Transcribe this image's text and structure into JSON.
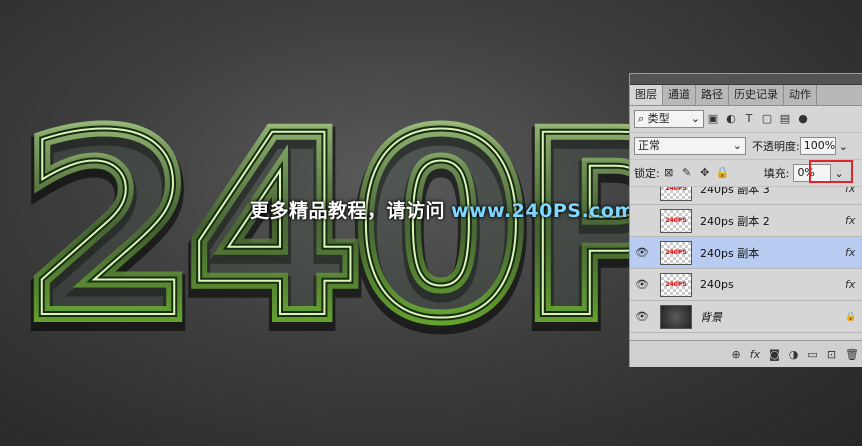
{
  "artwork": {
    "text": "240P"
  },
  "watermark": {
    "cn": "更多精品教程，请访问",
    "url": "www.240PS.com"
  },
  "panel": {
    "tabs": [
      "图层",
      "通道",
      "路径",
      "历史记录",
      "动作"
    ],
    "filter_label": "类型",
    "blend_mode": "正常",
    "opacity_label": "不透明度:",
    "opacity_value": "100%",
    "lock_label": "锁定:",
    "fill_label": "填充:",
    "fill_value": "0%",
    "layers": [
      {
        "name": "240ps 副本 3",
        "thumb_text": "240PS",
        "visible": false,
        "fx": "fx",
        "selected": false
      },
      {
        "name": "240ps 副本 2",
        "thumb_text": "240PS",
        "visible": false,
        "fx": "fx",
        "selected": false
      },
      {
        "name": "240ps 副本",
        "thumb_text": "240PS",
        "visible": true,
        "fx": "fx",
        "selected": true
      },
      {
        "name": "240ps",
        "thumb_text": "240PS",
        "visible": true,
        "fx": "fx",
        "selected": false
      },
      {
        "name": "背景",
        "thumb_text": "",
        "visible": true,
        "fx": "🔒",
        "selected": false
      }
    ],
    "icons": [
      "link-icon",
      "fx-icon",
      "mask-icon",
      "adjustment-icon",
      "group-icon",
      "new-layer-icon",
      "trash-icon"
    ],
    "accent_color": "#e0262a",
    "selected_color": "#b8ccf2"
  }
}
